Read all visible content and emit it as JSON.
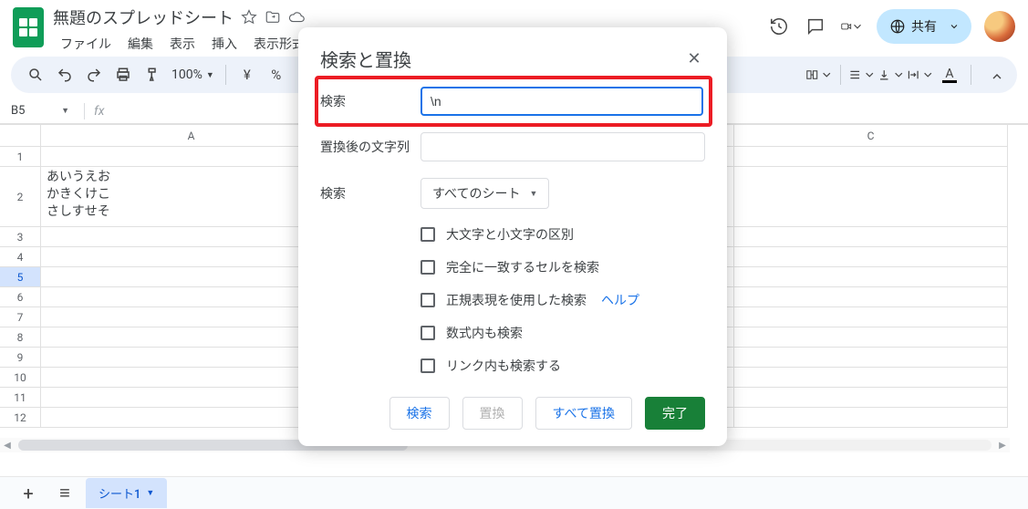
{
  "header": {
    "doc_title": "無題のスプレッドシート",
    "menus": [
      "ファイル",
      "編集",
      "表示",
      "挿入",
      "表示形式"
    ],
    "share_label": "共有",
    "zoom": "100%",
    "currency_symbol": "¥",
    "percent_symbol": "%"
  },
  "name_box": {
    "value": "B5"
  },
  "grid": {
    "columns": [
      "A",
      "C"
    ],
    "rows": [
      "1",
      "2",
      "3",
      "4",
      "5",
      "6",
      "7",
      "8",
      "9",
      "10",
      "11",
      "12"
    ],
    "selected_row": "5",
    "cells": {
      "A2": "あいうえお\nかきくけこ\nさしすせそ"
    }
  },
  "tabs": {
    "sheet1": "シート1"
  },
  "dialog": {
    "title": "検索と置換",
    "find_label": "検索",
    "find_value": "\\n",
    "replace_label": "置換後の文字列",
    "replace_value": "",
    "scope_label": "検索",
    "scope_selected": "すべてのシート",
    "checks": {
      "case": "大文字と小文字の区別",
      "whole": "完全に一致するセルを検索",
      "regex": "正規表現を使用した検索",
      "formulas": "数式内も検索",
      "links": "リンク内も検索する"
    },
    "help_label": "ヘルプ",
    "buttons": {
      "find": "検索",
      "replace": "置換",
      "replace_all": "すべて置換",
      "done": "完了"
    }
  }
}
